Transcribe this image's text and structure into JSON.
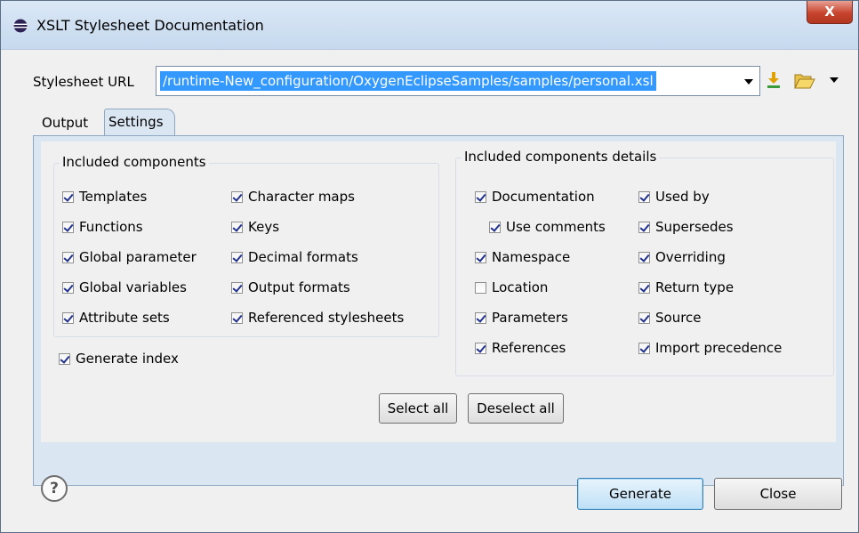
{
  "window": {
    "title": "XSLT Stylesheet Documentation",
    "close_label": "X"
  },
  "url": {
    "label": "Stylesheet URL",
    "value": "/runtime-New_configuration/OxygenEclipseSamples/samples/personal.xsl"
  },
  "tabs": [
    {
      "label": "Output"
    },
    {
      "label": "Settings"
    }
  ],
  "included_components": {
    "title": "Included components",
    "items": [
      {
        "label": "Templates",
        "checked": true
      },
      {
        "label": "Character maps",
        "checked": true
      },
      {
        "label": "Functions",
        "checked": true
      },
      {
        "label": "Keys",
        "checked": true
      },
      {
        "label": "Global parameter",
        "checked": true
      },
      {
        "label": "Decimal formats",
        "checked": true
      },
      {
        "label": "Global variables",
        "checked": true
      },
      {
        "label": "Output formats",
        "checked": true
      },
      {
        "label": "Attribute sets",
        "checked": true
      },
      {
        "label": "Referenced stylesheets",
        "checked": true
      }
    ]
  },
  "generate_index": {
    "label": "Generate index",
    "checked": true
  },
  "details": {
    "title": "Included components details",
    "items": [
      {
        "label": "Documentation",
        "checked": true
      },
      {
        "label": "Used by",
        "checked": true
      },
      {
        "label": "Use comments",
        "checked": true
      },
      {
        "label": "Supersedes",
        "checked": true
      },
      {
        "label": "Namespace",
        "checked": true
      },
      {
        "label": "Overriding",
        "checked": true
      },
      {
        "label": "Location",
        "checked": false
      },
      {
        "label": "Return type",
        "checked": true
      },
      {
        "label": "Parameters",
        "checked": true
      },
      {
        "label": "Source",
        "checked": true
      },
      {
        "label": "References",
        "checked": true
      },
      {
        "label": "Import precedence",
        "checked": true
      }
    ]
  },
  "buttons": {
    "select_all": "Select all",
    "deselect_all": "Deselect all",
    "generate": "Generate",
    "close": "Close"
  },
  "icons": {
    "app": "eclipse-icon",
    "download": "download-icon",
    "folder": "folder-open-icon",
    "help": "help-icon",
    "help_glyph": "?"
  },
  "colors": {
    "selection": "#3399ff",
    "tab_panel": "#dbe6f3",
    "default_button": "#bfe0f7"
  }
}
